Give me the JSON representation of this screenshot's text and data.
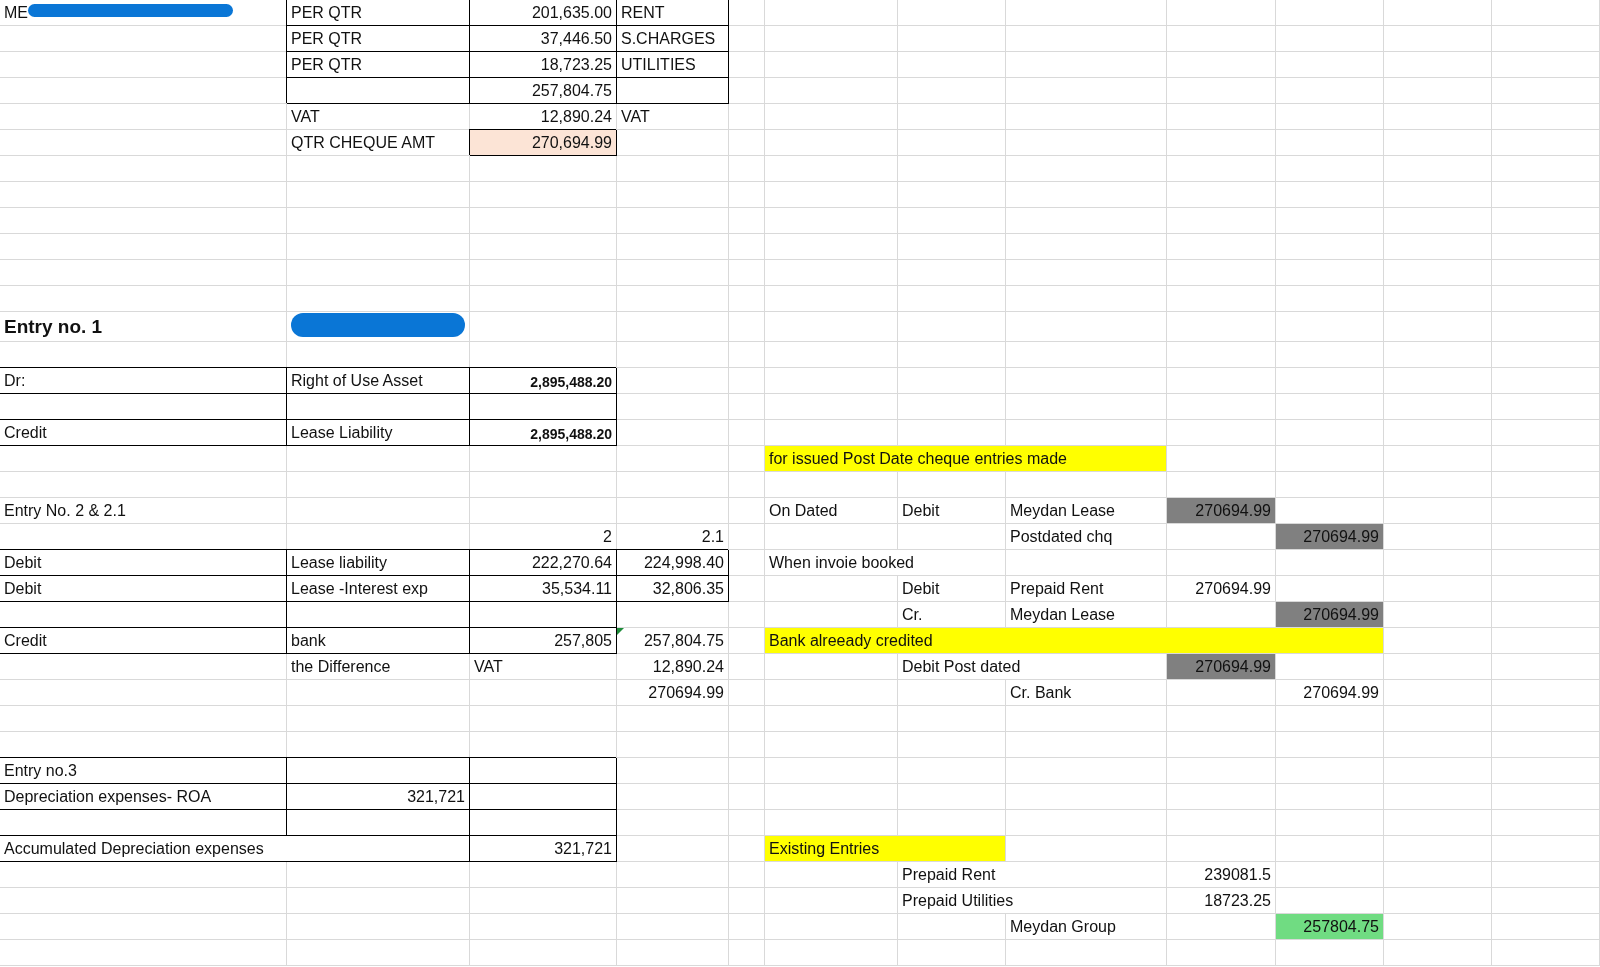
{
  "sheet": {
    "rows": [
      [
        {
          "kind": "text",
          "text": "ME",
          "redacted": true
        },
        {
          "kind": "text",
          "text": "PER QTR",
          "border": true
        },
        {
          "kind": "number",
          "text": "201,635.00",
          "border": true
        },
        {
          "kind": "text",
          "text": "RENT",
          "border": true
        },
        null,
        null,
        null,
        null,
        null,
        null,
        null,
        null
      ],
      [
        null,
        {
          "kind": "text",
          "text": "PER QTR",
          "border": true
        },
        {
          "kind": "number",
          "text": "37,446.50",
          "border": true
        },
        {
          "kind": "text",
          "text": "S.CHARGES",
          "border": true
        },
        null,
        null,
        null,
        null,
        null,
        null,
        null,
        null
      ],
      [
        null,
        {
          "kind": "text",
          "text": "PER QTR",
          "border": true
        },
        {
          "kind": "number",
          "text": "18,723.25",
          "border": true
        },
        {
          "kind": "text",
          "text": "UTILITIES",
          "border": true
        },
        null,
        null,
        null,
        null,
        null,
        null,
        null,
        null
      ],
      [
        null,
        {
          "kind": "blank",
          "border": true
        },
        {
          "kind": "number",
          "text": "257,804.75",
          "border": true
        },
        {
          "kind": "blank",
          "border": true
        },
        null,
        null,
        null,
        null,
        null,
        null,
        null,
        null
      ],
      [
        null,
        {
          "kind": "text",
          "text": "VAT"
        },
        {
          "kind": "number",
          "text": "12,890.24"
        },
        {
          "kind": "text",
          "text": "VAT"
        },
        null,
        null,
        null,
        null,
        null,
        null,
        null,
        null
      ],
      [
        null,
        {
          "kind": "text",
          "text": "QTR CHEQUE AMT"
        },
        {
          "kind": "number",
          "text": "270,694.99",
          "border": true,
          "color": "#fce4d6"
        },
        null,
        null,
        null,
        null,
        null,
        null,
        null,
        null,
        null
      ],
      [
        null,
        null,
        null,
        null,
        null,
        null,
        null,
        null,
        null,
        null,
        null,
        null
      ],
      [
        null,
        null,
        null,
        null,
        null,
        null,
        null,
        null,
        null,
        null,
        null,
        null
      ],
      [
        null,
        null,
        null,
        null,
        null,
        null,
        null,
        null,
        null,
        null,
        null,
        null
      ],
      [
        null,
        null,
        null,
        null,
        null,
        null,
        null,
        null,
        null,
        null,
        null,
        null
      ],
      [
        null,
        null,
        null,
        null,
        null,
        null,
        null,
        null,
        null,
        null,
        null,
        null
      ],
      [
        null,
        null,
        null,
        null,
        null,
        null,
        null,
        null,
        null,
        null,
        null,
        null
      ],
      [
        {
          "kind": "heading",
          "text": "Entry no. 1"
        },
        {
          "kind": "blank",
          "redacted": true
        },
        null,
        null,
        null,
        null,
        null,
        null,
        null,
        null,
        null,
        null
      ],
      [
        null,
        null,
        null,
        null,
        null,
        null,
        null,
        null,
        null,
        null,
        null,
        null
      ],
      [
        {
          "kind": "text",
          "text": "Dr:",
          "border": true
        },
        {
          "kind": "text",
          "text": "Right of Use Asset",
          "border": true
        },
        {
          "kind": "strong-number",
          "text": "2,895,488.20",
          "border": true
        },
        null,
        null,
        null,
        null,
        null,
        null,
        null,
        null,
        null
      ],
      [
        {
          "kind": "blank",
          "border": true
        },
        {
          "kind": "blank",
          "border": true
        },
        {
          "kind": "blank",
          "border": true
        },
        null,
        null,
        null,
        null,
        null,
        null,
        null,
        null,
        null
      ],
      [
        {
          "kind": "text",
          "text": "Credit",
          "border": true
        },
        {
          "kind": "text",
          "text": "Lease Liability",
          "border": true
        },
        {
          "kind": "strong-number",
          "text": "2,895,488.20",
          "border": true
        },
        null,
        null,
        null,
        null,
        null,
        null,
        null,
        null,
        null
      ],
      [
        null,
        null,
        null,
        null,
        null,
        {
          "kind": "text",
          "text": "for issued Post Date cheque entries made",
          "color": "#ffff00"
        },
        {
          "kind": "blank",
          "color": "#ffff00"
        },
        {
          "kind": "blank",
          "color": "#ffff00"
        },
        null,
        null,
        null,
        null
      ],
      [
        null,
        null,
        null,
        null,
        null,
        null,
        null,
        null,
        null,
        null,
        null,
        null
      ],
      [
        {
          "kind": "text",
          "text": "Entry No. 2 & 2.1"
        },
        null,
        null,
        null,
        null,
        {
          "kind": "text",
          "text": "On Dated"
        },
        {
          "kind": "text",
          "text": "Debit"
        },
        {
          "kind": "text",
          "text": "Meydan Lease"
        },
        {
          "kind": "number",
          "text": "270694.99",
          "color": "#808080"
        },
        null,
        null,
        null
      ],
      [
        null,
        null,
        {
          "kind": "number",
          "text": "2"
        },
        {
          "kind": "number",
          "text": "2.1"
        },
        null,
        null,
        null,
        {
          "kind": "text",
          "text": "Postdated chq"
        },
        null,
        {
          "kind": "number",
          "text": "270694.99",
          "color": "#808080"
        },
        null,
        null
      ],
      [
        {
          "kind": "text",
          "text": "Debit",
          "border": true
        },
        {
          "kind": "text",
          "text": "Lease liability",
          "border": true
        },
        {
          "kind": "number",
          "text": "222,270.64",
          "border": true
        },
        {
          "kind": "number",
          "text": "224,998.40",
          "border": true
        },
        null,
        {
          "kind": "text",
          "text": "When invoie booked"
        },
        null,
        null,
        null,
        null,
        null,
        null
      ],
      [
        {
          "kind": "text",
          "text": "Debit",
          "border": true
        },
        {
          "kind": "text",
          "text": "Lease -Interest exp",
          "border": true
        },
        {
          "kind": "number",
          "text": "35,534.11",
          "border": true
        },
        {
          "kind": "number",
          "text": "32,806.35",
          "border": true
        },
        null,
        null,
        {
          "kind": "text",
          "text": "Debit"
        },
        {
          "kind": "text",
          "text": "Prepaid Rent"
        },
        {
          "kind": "number",
          "text": "270694.99"
        },
        null,
        null,
        null
      ],
      [
        {
          "kind": "blank",
          "border": true
        },
        {
          "kind": "blank",
          "border": true
        },
        {
          "kind": "blank",
          "border": true
        },
        null,
        null,
        null,
        {
          "kind": "text",
          "text": "Cr."
        },
        {
          "kind": "text",
          "text": "Meydan Lease"
        },
        null,
        {
          "kind": "number",
          "text": "270694.99",
          "color": "#808080"
        },
        null,
        null
      ],
      [
        {
          "kind": "text",
          "text": "Credit",
          "border": true
        },
        {
          "kind": "text",
          "text": "bank",
          "border": true
        },
        {
          "kind": "number",
          "text": "257,805",
          "border": true
        },
        {
          "kind": "number",
          "text": "257,804.75",
          "flag": true
        },
        null,
        {
          "kind": "text",
          "text": "Bank alreeady credited",
          "color": "#ffff00"
        },
        {
          "kind": "blank",
          "color": "#ffff00"
        },
        {
          "kind": "blank",
          "color": "#ffff00"
        },
        {
          "kind": "blank",
          "color": "#ffff00"
        },
        {
          "kind": "blank",
          "color": "#ffff00"
        },
        null,
        null
      ],
      [
        null,
        {
          "kind": "text",
          "text": "the Difference"
        },
        {
          "kind": "text",
          "text": "VAT"
        },
        {
          "kind": "number",
          "text": "12,890.24"
        },
        null,
        null,
        {
          "kind": "text",
          "text": "Debit Post dated"
        },
        null,
        {
          "kind": "number",
          "text": "270694.99",
          "color": "#808080"
        },
        null,
        null,
        null
      ],
      [
        null,
        null,
        null,
        {
          "kind": "number",
          "text": "270694.99"
        },
        null,
        null,
        null,
        {
          "kind": "text",
          "text": "Cr. Bank"
        },
        null,
        {
          "kind": "number",
          "text": "270694.99"
        },
        null,
        null
      ],
      [
        null,
        null,
        null,
        null,
        null,
        null,
        null,
        null,
        null,
        null,
        null,
        null
      ],
      [
        null,
        null,
        null,
        null,
        null,
        null,
        null,
        null,
        null,
        null,
        null,
        null
      ],
      [
        {
          "kind": "text",
          "text": "Entry no.3",
          "border": true
        },
        {
          "kind": "blank",
          "border": true
        },
        {
          "kind": "blank",
          "border": true
        },
        null,
        null,
        null,
        null,
        null,
        null,
        null,
        null,
        null
      ],
      [
        {
          "kind": "text",
          "text": "Depreciation expenses- ROA",
          "border": true
        },
        {
          "kind": "number",
          "text": "321,721",
          "border": true
        },
        {
          "kind": "blank",
          "border": true
        },
        null,
        null,
        null,
        null,
        null,
        null,
        null,
        null,
        null
      ],
      [
        {
          "kind": "blank",
          "border": true
        },
        {
          "kind": "blank",
          "border": true
        },
        {
          "kind": "blank",
          "border": true
        },
        null,
        null,
        null,
        null,
        null,
        null,
        null,
        null,
        null
      ],
      [
        {
          "kind": "text",
          "text": "Accumulated Depreciation expenses",
          "border": true
        },
        null,
        {
          "kind": "number",
          "text": "321,721",
          "border": true
        },
        null,
        null,
        {
          "kind": "text",
          "text": "Existing Entries",
          "color": "#ffff00"
        },
        null,
        null,
        null,
        null,
        null,
        null
      ],
      [
        null,
        null,
        null,
        null,
        null,
        null,
        {
          "kind": "text",
          "text": "Prepaid Rent"
        },
        null,
        {
          "kind": "number",
          "text": "239081.5"
        },
        null,
        null,
        null
      ],
      [
        null,
        null,
        null,
        null,
        null,
        null,
        {
          "kind": "text",
          "text": "Prepaid Utilities"
        },
        null,
        {
          "kind": "number",
          "text": "18723.25"
        },
        null,
        null,
        null
      ],
      [
        null,
        null,
        null,
        null,
        null,
        null,
        null,
        {
          "kind": "text",
          "text": "Meydan Group"
        },
        null,
        {
          "kind": "number",
          "text": "257804.75",
          "color": "#70dc82"
        },
        null,
        null
      ],
      [
        null,
        null,
        null,
        null,
        null,
        null,
        null,
        null,
        null,
        null,
        null,
        null
      ]
    ]
  }
}
